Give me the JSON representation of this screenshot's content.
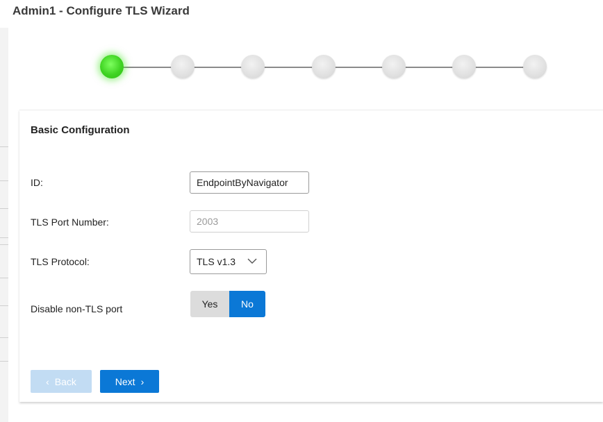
{
  "window": {
    "title": "Admin1 - Configure TLS Wizard"
  },
  "stepper": {
    "total_steps": 7,
    "current_step": 1
  },
  "panel": {
    "section_title": "Basic Configuration",
    "fields": {
      "id": {
        "label": "ID:",
        "value": "EndpointByNavigator"
      },
      "tls_port": {
        "label": "TLS Port Number:",
        "value": "2003"
      },
      "tls_protocol": {
        "label": "TLS Protocol:",
        "selected": "TLS v1.3"
      },
      "disable_non_tls": {
        "label": "Disable non-TLS port",
        "yes_label": "Yes",
        "no_label": "No",
        "selected": "No"
      }
    }
  },
  "footer": {
    "back_label": "Back",
    "next_label": "Next"
  },
  "colors": {
    "primary": "#0b78d6",
    "primary_disabled": "#c2dcf3",
    "active_step": "#3fd322"
  },
  "icons": {
    "back_arrow": "chevron-left-icon",
    "next_arrow": "chevron-right-icon",
    "select_chevron": "chevron-down-icon"
  }
}
